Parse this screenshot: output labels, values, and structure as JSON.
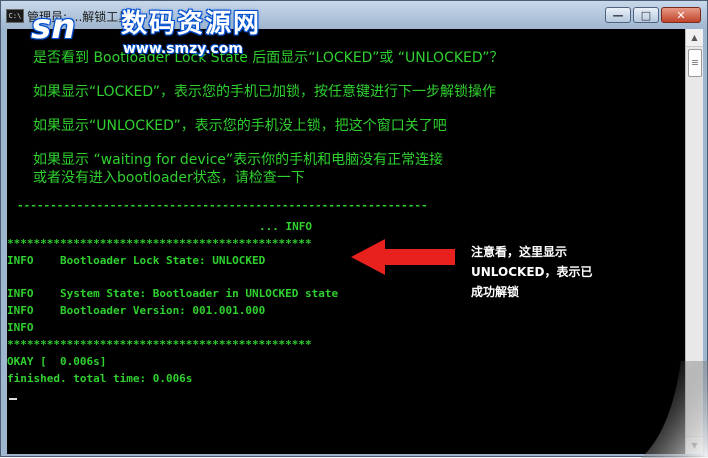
{
  "window": {
    "title": "管理员: ...解锁工具",
    "icon_text": "C:\\",
    "controls": {
      "minimize": "—",
      "maximize": "□",
      "close": "✕"
    }
  },
  "watermark": {
    "logo": "sn",
    "name": "数码资源网",
    "url": "www.smzy.com"
  },
  "instructions": [
    "是否看到 Bootloader Lock State 后面显示“LOCKED”或 “UNLOCKED”？",
    "如果显示“LOCKED”，表示您的手机已加锁，按任意键进行下一步解锁操作",
    "如果显示“UNLOCKED”，表示您的手机没上锁，把这个窗口关了吧",
    "如果显示 “waiting for device”表示你的手机和电脑没有正常连接",
    "或者没有进入bootloader状态，请检查一下"
  ],
  "output": {
    "separator_dash": "--------------------------------------------------------------",
    "info_header": "... INFO",
    "stars": "**********************************************",
    "lock_state_line": "INFO    Bootloader Lock State: UNLOCKED",
    "system_state_line": "INFO    System State: Bootloader in UNLOCKED state",
    "version_line": "INFO    Bootloader Version: 001.001.000",
    "info_blank_line": "INFO",
    "okay_line": "OKAY [  0.006s]",
    "finished_line": "finished. total time: 0.006s"
  },
  "annotation": {
    "line1": "注意看，这里显示",
    "line2": "UNLOCKED，表示已",
    "line3": "成功解锁",
    "arrow_color": "#e8201e"
  },
  "colors": {
    "console_bg": "#000000",
    "console_text": "#2fd12f"
  }
}
